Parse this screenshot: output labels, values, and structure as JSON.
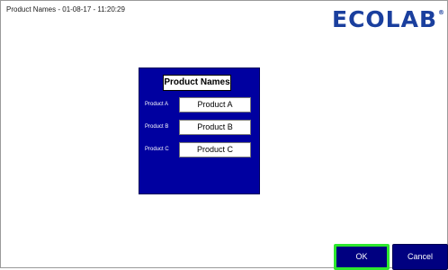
{
  "header": {
    "title": "Product Names - 01-08-17 - 11:20:29",
    "logo_text": "ECOLAB",
    "logo_mark": "®",
    "logo_color": "#1a3f9e"
  },
  "panel": {
    "title": "Product Names",
    "background": "#0000a0",
    "rows": [
      {
        "label": "Product A",
        "value": "Product A"
      },
      {
        "label": "Product B",
        "value": "Product B"
      },
      {
        "label": "Product C",
        "value": "Product C"
      }
    ]
  },
  "buttons": {
    "ok_label": "OK",
    "cancel_label": "Cancel",
    "ok_focus_color": "#2ee82e",
    "button_color": "#000080"
  }
}
